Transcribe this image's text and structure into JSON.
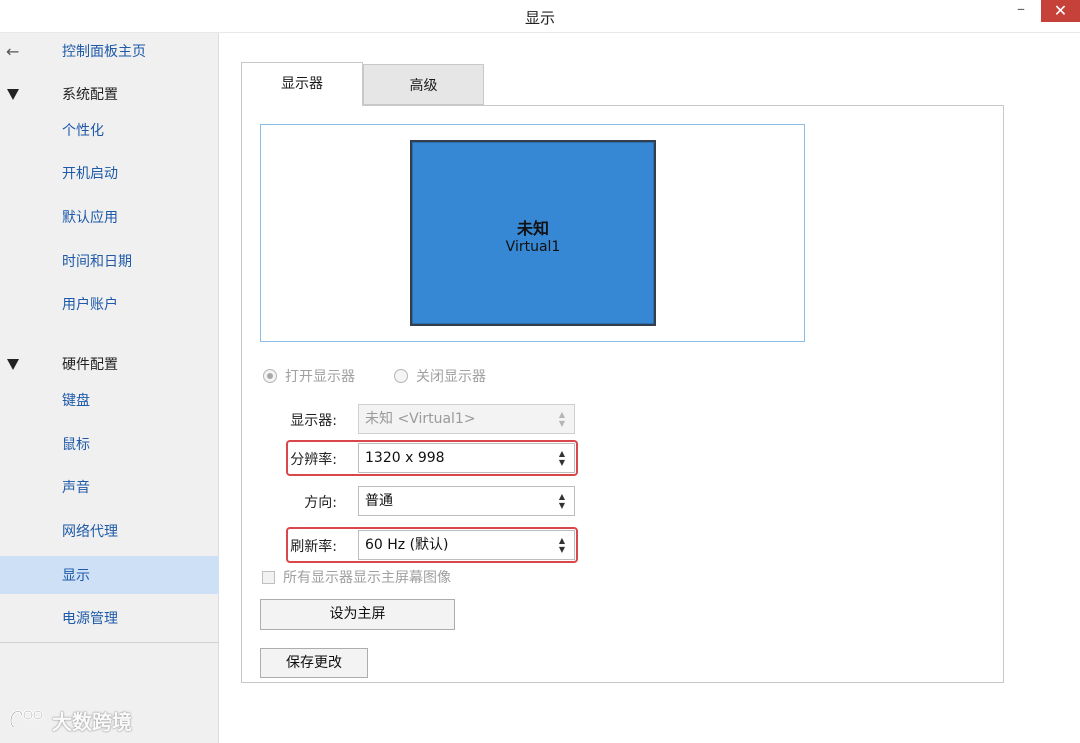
{
  "window": {
    "title": "显示",
    "minimize_label": "–",
    "close_label": "✕"
  },
  "sidebar": {
    "home": "控制面板主页",
    "sections": [
      {
        "title": "系统配置",
        "items": [
          "个性化",
          "开机启动",
          "默认应用",
          "时间和日期",
          "用户账户"
        ]
      },
      {
        "title": "硬件配置",
        "items": [
          "键盘",
          "鼠标",
          "声音",
          "网络代理",
          "显示",
          "电源管理"
        ]
      }
    ],
    "selected": "显示"
  },
  "watermark": {
    "text": "大数跨境"
  },
  "tabs": [
    {
      "label": "显示器",
      "active": true
    },
    {
      "label": "高级",
      "active": false
    }
  ],
  "preview": {
    "monitor_name": "未知",
    "monitor_id": "Virtual1"
  },
  "display_toggle": {
    "on_label": "打开显示器",
    "off_label": "关闭显示器",
    "selected": "on"
  },
  "fields": {
    "monitor": {
      "label": "显示器:",
      "value": "未知 <Virtual1>",
      "enabled": false
    },
    "resolution": {
      "label": "分辨率:",
      "value": "1320 x 998"
    },
    "orientation": {
      "label": "方向:",
      "value": "普通"
    },
    "refresh_rate": {
      "label": "刷新率:",
      "value": "60 Hz (默认)"
    }
  },
  "mirror_checkbox": {
    "label": "所有显示器显示主屏幕图像",
    "checked": false
  },
  "buttons": {
    "set_primary": "设为主屏",
    "save": "保存更改"
  },
  "colors": {
    "close_button": "#c7413b",
    "selected_sidebar": "#cde0f5",
    "monitor_fill": "#3688d4",
    "highlight_box": "#d9474a",
    "link": "#1e5aa8"
  }
}
